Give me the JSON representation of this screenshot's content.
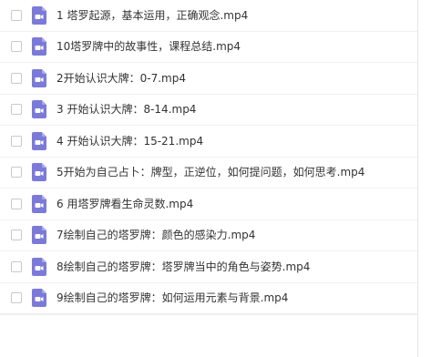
{
  "colors": {
    "video_icon": "#7b7ad9",
    "text": "#333333"
  },
  "files": [
    {
      "name": "1 塔罗起源，基本运用，正确观念.mp4",
      "icon": "video-file-icon"
    },
    {
      "name": "10塔罗牌中的故事性，课程总结.mp4",
      "icon": "video-file-icon"
    },
    {
      "name": "2开始认识大牌：0-7.mp4",
      "icon": "video-file-icon"
    },
    {
      "name": "3 开始认识大牌：8-14.mp4",
      "icon": "video-file-icon"
    },
    {
      "name": "4 开始认识大牌：15-21.mp4",
      "icon": "video-file-icon"
    },
    {
      "name": "5开始为自己占卜：牌型，正逆位，如何提问题，如何思考.mp4",
      "icon": "video-file-icon"
    },
    {
      "name": "6 用塔罗牌看生命灵数.mp4",
      "icon": "video-file-icon"
    },
    {
      "name": "7绘制自己的塔罗牌：颜色的感染力.mp4",
      "icon": "video-file-icon"
    },
    {
      "name": "8绘制自己的塔罗牌：塔罗牌当中的角色与姿势.mp4",
      "icon": "video-file-icon"
    },
    {
      "name": "9绘制自己的塔罗牌：如何运用元素与背景.mp4",
      "icon": "video-file-icon"
    }
  ]
}
